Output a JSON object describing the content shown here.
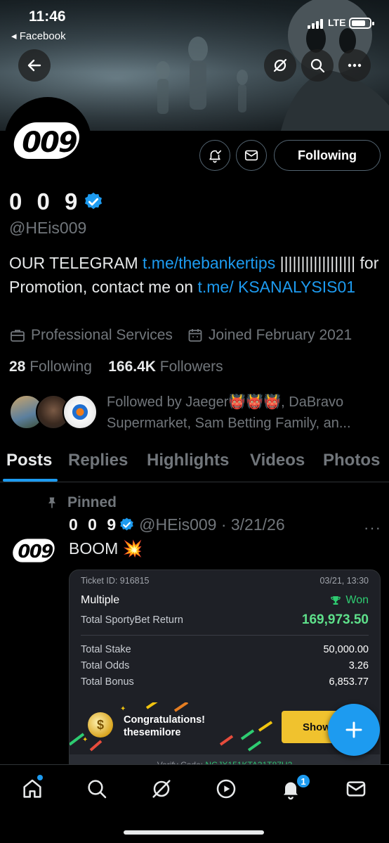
{
  "status_bar": {
    "time": "11:46",
    "back_app": "◂ Facebook",
    "network": "LTE",
    "battery_level": 0.8
  },
  "profile": {
    "avatar_text": "009",
    "display_name": "0 0 9",
    "handle": "@HEis009",
    "following_button": "Following",
    "bio_prefix": "OUR TELEGRAM ",
    "bio_link1": "t.me/thebankertips",
    "bio_middle": " |||||||||||||||||| for Promotion, contact me on ",
    "bio_link2": "t.me/ KSANALYSIS01",
    "category": "Professional Services",
    "joined": "Joined February 2021",
    "following_count": "28",
    "following_label": " Following",
    "followers_count": "166.4K",
    "followers_label": " Followers",
    "followed_by": "Followed by Jaeger👹👹👹, DaBravo Supermarket, Sam Betting Family, an..."
  },
  "tabs": [
    "Posts",
    "Replies",
    "Highlights",
    "Videos",
    "Photos"
  ],
  "post": {
    "pinned_label": "Pinned",
    "name": "0 0 9",
    "handle_date": "@HEis009 · 3/21/26",
    "text": "BOOM 💥",
    "more": "···"
  },
  "ticket": {
    "ticket_id": "Ticket ID: 916815",
    "date": "03/21, 13:30",
    "type": "Multiple",
    "status": "Won",
    "return_label": "Total SportyBet Return",
    "return_value": "169,973.50",
    "rows": [
      {
        "label": "Total Stake",
        "value": "50,000.00"
      },
      {
        "label": "Total Odds",
        "value": "3.26"
      },
      {
        "label": "Total Bonus",
        "value": "6,853.77"
      }
    ],
    "congrats_line1": "Congratulations!",
    "congrats_line2": "thesemilore",
    "show_button": "Show",
    "verify_label": "Verify Code: ",
    "verify_code": "NGJX151KTA31T87U2"
  },
  "nav": {
    "notifications_badge": "1"
  },
  "colors": {
    "accent": "#1d9bf0",
    "won_green": "#2ecc71",
    "show_yellow": "#f0c22e"
  }
}
